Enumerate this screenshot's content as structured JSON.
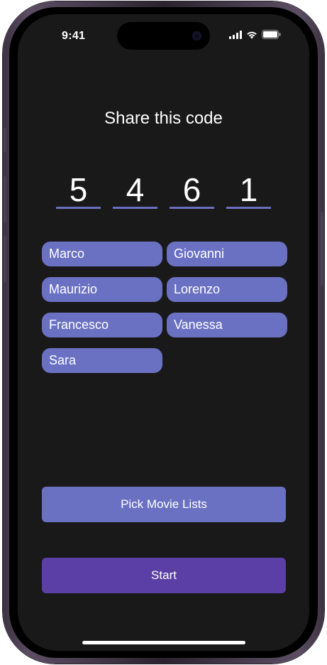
{
  "status_bar": {
    "time": "9:41",
    "icons": [
      "cellular-signal-icon",
      "wifi-icon",
      "battery-icon"
    ]
  },
  "title": "Share this code",
  "code": [
    "5",
    "4",
    "6",
    "1"
  ],
  "players": [
    "Marco",
    "Giovanni",
    "Maurizio",
    "Lorenzo",
    "Francesco",
    "Vanessa",
    "Sara"
  ],
  "buttons": {
    "pick_movie_lists": "Pick Movie Lists",
    "start": "Start"
  },
  "colors": {
    "background": "#1a1919",
    "chip": "#6b71c2",
    "pick_button": "#6b71c2",
    "start_button": "#5b3fa6",
    "code_underline": "#6a6fbf"
  }
}
